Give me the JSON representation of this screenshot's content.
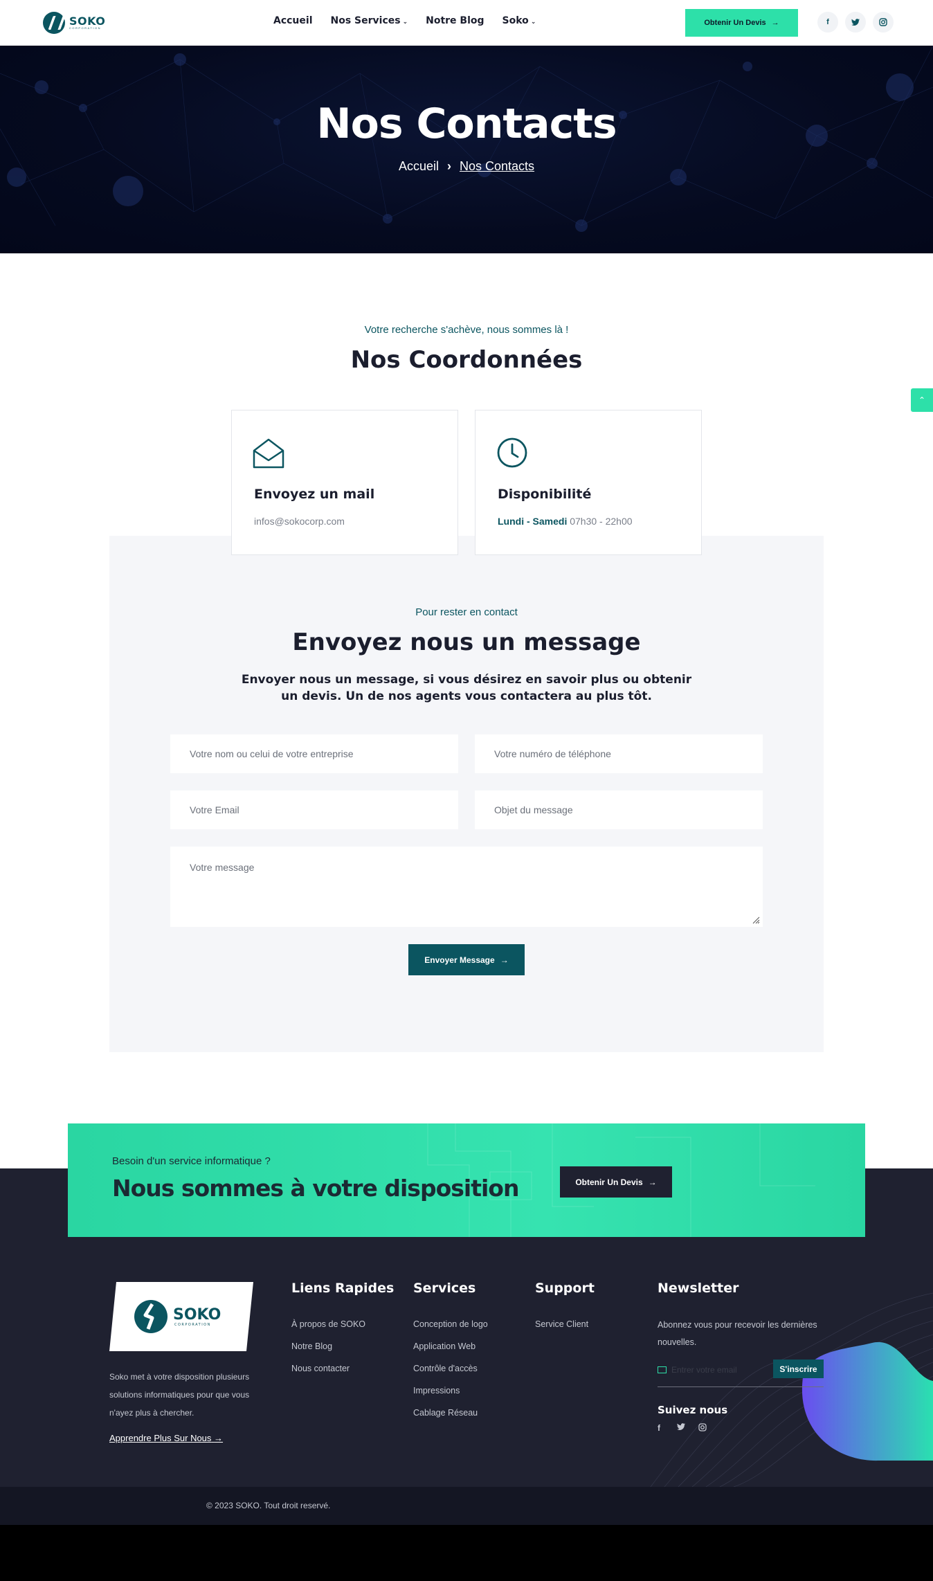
{
  "header": {
    "logo_name": "SOKO",
    "logo_sub": "CORPORATION",
    "nav": [
      {
        "label": "Accueil",
        "dropdown": false
      },
      {
        "label": "Nos Services",
        "dropdown": true
      },
      {
        "label": "Notre Blog",
        "dropdown": false
      },
      {
        "label": "Soko",
        "dropdown": true
      }
    ],
    "cta_label": "Obtenir Un Devis",
    "social": [
      "facebook-icon",
      "twitter-icon",
      "instagram-icon"
    ]
  },
  "hero": {
    "title": "Nos Contacts",
    "breadcrumb_home": "Accueil",
    "breadcrumb_current": "Nos Contacts"
  },
  "coords": {
    "subtitle": "Votre recherche s'achève, nous sommes là !",
    "title": "Nos Coordonnées",
    "cards": [
      {
        "icon": "mail-open-icon",
        "title": "Envoyez un mail",
        "text": "infos@sokocorp.com"
      },
      {
        "icon": "clock-icon",
        "title": "Disponibilité",
        "days": "Lundi - Samedi",
        "hours": "07h30 - 22h00"
      }
    ]
  },
  "form": {
    "subtitle": "Pour rester en contact",
    "title": "Envoyez nous un message",
    "lead": "Envoyer nous un message, si vous désirez en savoir plus ou obtenir un devis. Un de nos agents vous contactera au plus tôt.",
    "name_placeholder": "Votre nom ou celui de votre entreprise",
    "phone_placeholder": "Votre numéro de téléphone",
    "email_placeholder": "Votre Email",
    "subject_placeholder": "Objet du message",
    "message_placeholder": "Votre message",
    "submit_label": "Envoyer Message"
  },
  "banner": {
    "subtitle": "Besoin d'un service informatique ?",
    "title": "Nous sommes à votre disposition",
    "button_label": "Obtenir Un Devis"
  },
  "footer": {
    "about": "Soko met à votre disposition plusieurs solutions informatiques pour que vous n'ayez plus à chercher.",
    "about_link": "Apprendre Plus Sur Nous",
    "quick_title": "Liens Rapides",
    "quick_links": [
      "À propos de SOKO",
      "Notre Blog",
      "Nous contacter"
    ],
    "services_title": "Services",
    "services_links": [
      "Conception de logo",
      "Application Web",
      "Contrôle d'accès",
      "Impressions",
      "Cablage Réseau"
    ],
    "support_title": "Support",
    "support_links": [
      "Service Client"
    ],
    "newsletter_title": "Newsletter",
    "newsletter_text": "Abonnez vous pour recevoir les dernières nouvelles.",
    "newsletter_placeholder": "Entrer votre email",
    "newsletter_button": "S'inscrire",
    "follow_title": "Suivez nous",
    "copyright": "© 2023 SOKO. Tout droit reservé."
  },
  "colors": {
    "accent": "#2de0a9",
    "brand": "#0b5560",
    "dark": "#1f2130"
  }
}
